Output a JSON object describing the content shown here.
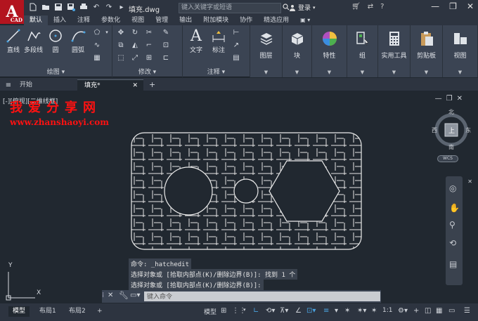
{
  "app": {
    "logo_letter": "A",
    "logo_sub": "CAD",
    "doc_title": "填充.dwg"
  },
  "titlebar": {
    "search_placeholder": "键入关键字或短语",
    "login_label": "登录",
    "minimize": "—",
    "maximize": "❐",
    "close": "✕"
  },
  "ribbon_tabs": [
    "默认",
    "插入",
    "注释",
    "参数化",
    "视图",
    "管理",
    "输出",
    "附加模块",
    "协作",
    "精选应用"
  ],
  "ribbon": {
    "draw": {
      "title": "绘图",
      "line": "直线",
      "polyline": "多段线",
      "circle": "圆",
      "arc": "圆弧"
    },
    "modify": {
      "title": "修改"
    },
    "annotation": {
      "title": "注释",
      "text": "文字",
      "dimension": "标注"
    },
    "layers": "图层",
    "block": "块",
    "properties": "特性",
    "group": "组",
    "utilities": "实用工具",
    "clipboard": "剪贴板",
    "view": "视图"
  },
  "file_tabs": [
    {
      "label": "开始"
    },
    {
      "label": "填充*",
      "close": "✕"
    }
  ],
  "viewport": {
    "label": "[-][俯视][二维线框]",
    "watermark_cn": "我爱分享网",
    "watermark_url": "www.zhanshaoyi.com"
  },
  "viewcube": {
    "north": "北",
    "south": "南",
    "east": "东",
    "west": "西",
    "top": "上",
    "wcs": "WCS"
  },
  "ucs": {
    "x": "X",
    "y": "Y"
  },
  "command_history": [
    "命令: _hatchedit",
    "选择对象或 [拾取内部点(K)/删除边界(B)]: 找到 1 个",
    "选择对象或 [拾取内部点(K)/删除边界(B)]:"
  ],
  "command_input_placeholder": "键入命令",
  "layout_tabs": [
    "模型",
    "布局1",
    "布局2"
  ],
  "status": {
    "model_label": "模型",
    "scale": "1:1",
    "plus": "+"
  }
}
